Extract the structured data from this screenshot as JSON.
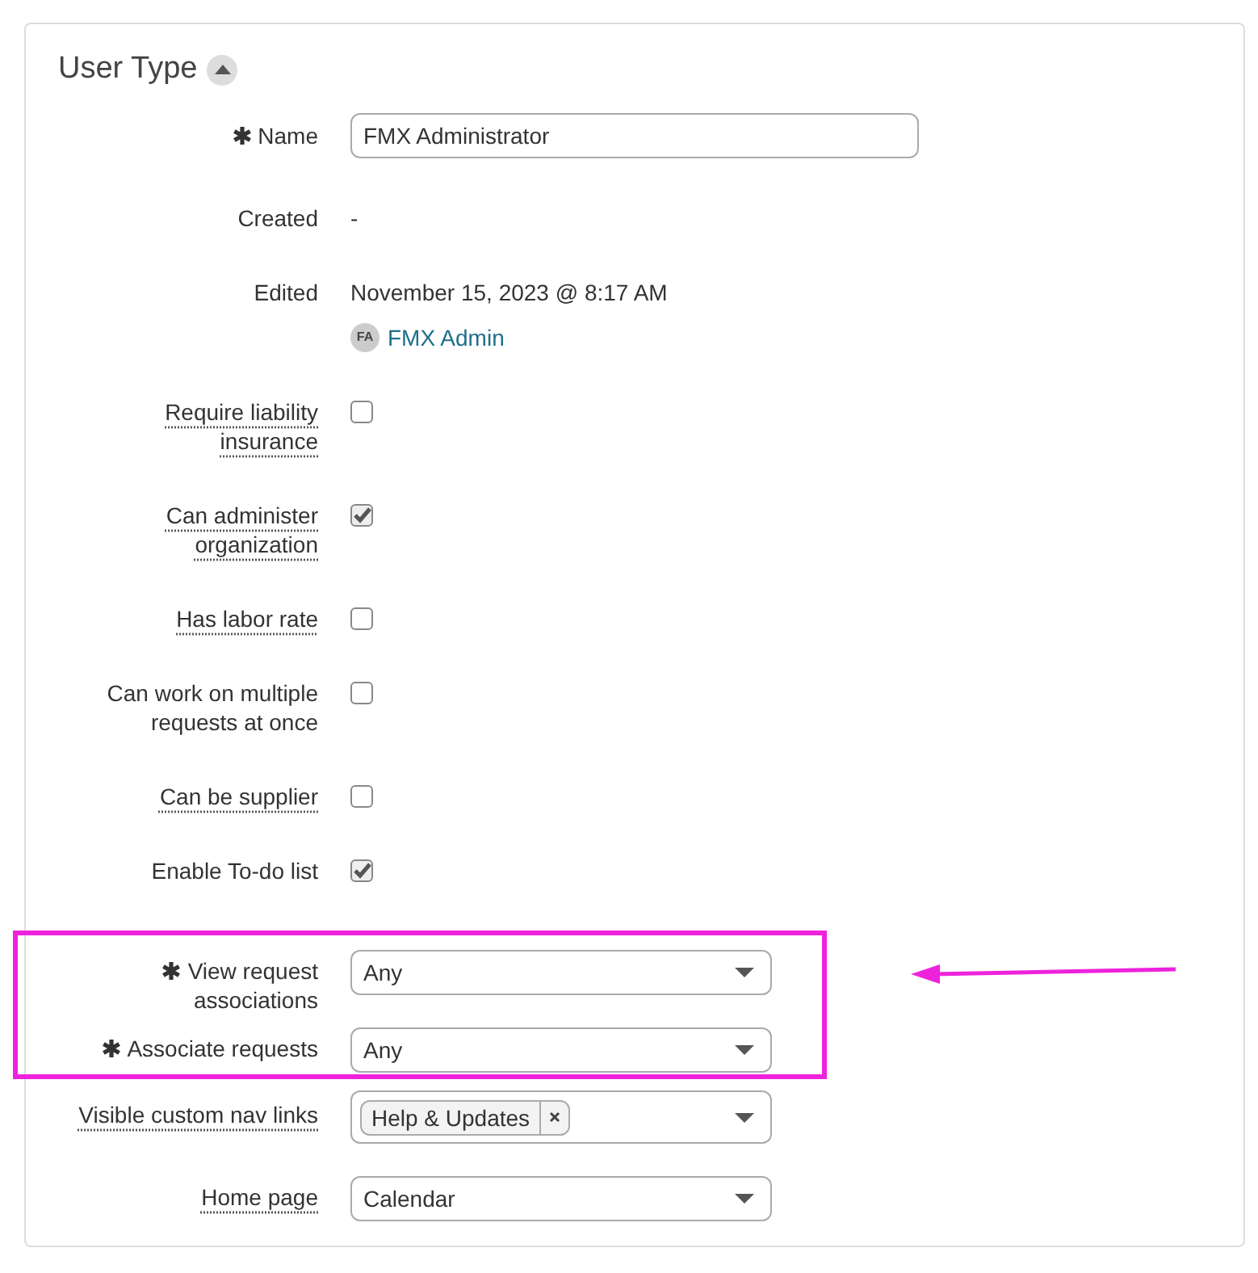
{
  "section": {
    "title": "User Type",
    "expanded": true
  },
  "fields": [
    {
      "kind": "text_input",
      "label": "Name",
      "required": true,
      "has_tooltip": false,
      "highlighted": false,
      "value": "FMX Administrator"
    },
    {
      "kind": "static",
      "label": "Created",
      "required": false,
      "has_tooltip": false,
      "highlighted": false,
      "value": "-"
    },
    {
      "kind": "edited",
      "label": "Edited",
      "required": false,
      "has_tooltip": false,
      "highlighted": false,
      "value": "November 15, 2023 @ 8:17 AM",
      "user": {
        "initials": "FA",
        "name": "FMX Admin"
      }
    },
    {
      "kind": "checkbox",
      "label": "Require liability\ninsurance",
      "required": false,
      "has_tooltip": true,
      "highlighted": false,
      "checked": false
    },
    {
      "kind": "checkbox",
      "label": "Can administer\norganization",
      "required": false,
      "has_tooltip": true,
      "highlighted": false,
      "checked": true
    },
    {
      "kind": "checkbox",
      "label": "Has labor rate",
      "required": false,
      "has_tooltip": true,
      "highlighted": false,
      "checked": false
    },
    {
      "kind": "checkbox",
      "label": "Can work on multiple\nrequests at once",
      "required": false,
      "has_tooltip": false,
      "highlighted": false,
      "checked": false
    },
    {
      "kind": "checkbox",
      "label": "Can be supplier",
      "required": false,
      "has_tooltip": true,
      "highlighted": false,
      "checked": false
    },
    {
      "kind": "checkbox",
      "label": "Enable To-do list",
      "required": false,
      "has_tooltip": false,
      "highlighted": false,
      "checked": true
    },
    {
      "kind": "select",
      "label": "View request\nassociations",
      "required": true,
      "has_tooltip": false,
      "highlighted": true,
      "value": "Any"
    },
    {
      "kind": "select",
      "label": "Associate requests",
      "required": true,
      "has_tooltip": false,
      "highlighted": true,
      "value": "Any"
    },
    {
      "kind": "multiselect",
      "label": "Visible custom nav links",
      "required": false,
      "has_tooltip": true,
      "highlighted": false,
      "tags": [
        "Help & Updates"
      ]
    },
    {
      "kind": "select",
      "label": "Home page",
      "required": false,
      "has_tooltip": true,
      "highlighted": false,
      "value": "Calendar"
    }
  ],
  "annotation": {
    "kind": "arrow"
  }
}
